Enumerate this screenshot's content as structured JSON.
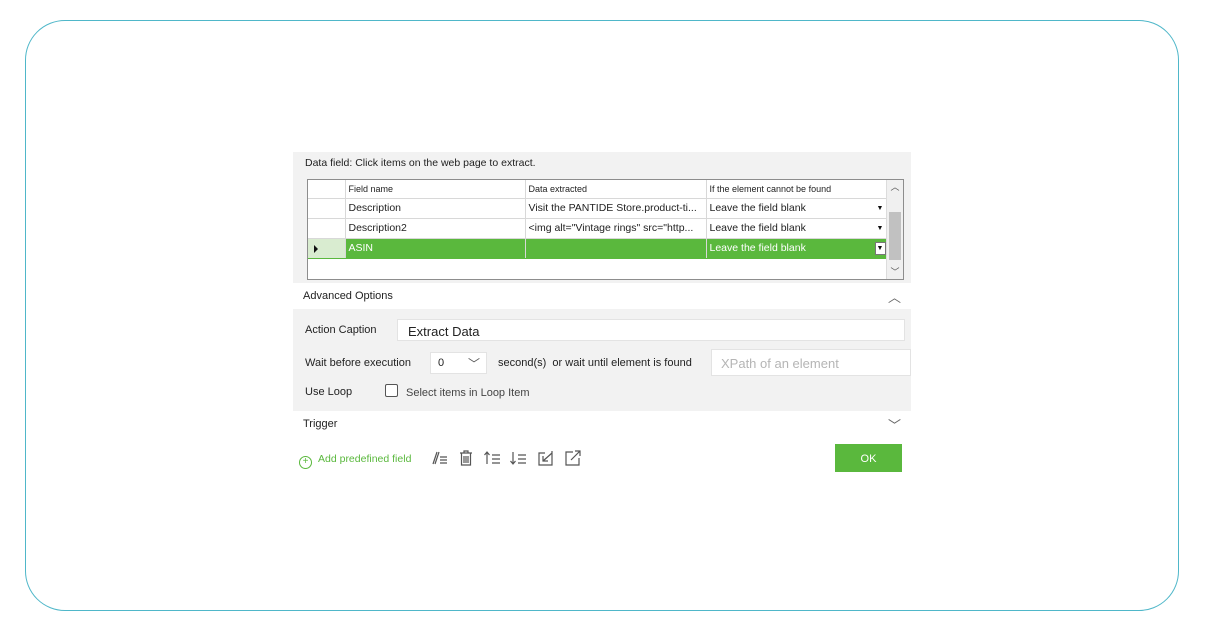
{
  "data_field": {
    "instruction": "Data field: Click items on the web page to extract."
  },
  "grid": {
    "headers": [
      "Field name",
      "Data extracted",
      "If the element cannot be found"
    ],
    "rows": [
      {
        "field": "Description",
        "data": "Visit the PANTIDE Store.product-ti...",
        "fallback": "Leave the field blank"
      },
      {
        "field": "Description2",
        "data": "<img alt=\"Vintage rings\" src=\"http...",
        "fallback": "Leave the field blank"
      },
      {
        "field": "ASIN",
        "data": "",
        "fallback": "Leave the field blank"
      }
    ],
    "selected_row": 2
  },
  "advanced": {
    "title": "Advanced Options",
    "action_caption_label": "Action Caption",
    "action_caption_value": "Extract Data",
    "wait_label": "Wait before execution",
    "wait_value": "0",
    "wait_suffix": "second(s)  or wait until element is found",
    "xpath_placeholder": "XPath of an element",
    "use_loop_label": "Use Loop",
    "loop_checkbox_label": "Select items in Loop Item",
    "loop_checked": false
  },
  "trigger": {
    "title": "Trigger"
  },
  "toolbar": {
    "add_label": "Add predefined field",
    "ok_label": "OK"
  },
  "colors": {
    "accent_green": "#5ab83d",
    "frame_border": "#4fb7c9"
  }
}
